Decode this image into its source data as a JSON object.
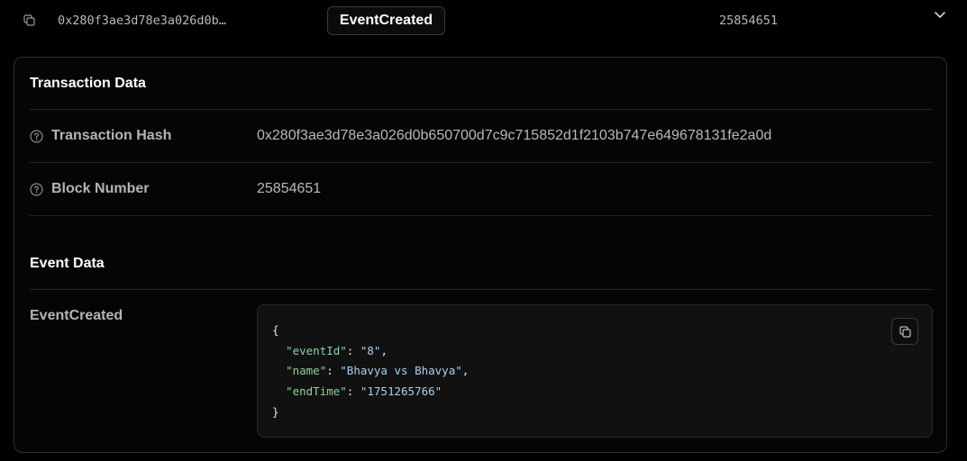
{
  "top": {
    "hash": "0x280f3ae3d78e3a026d0b…",
    "event_name": "EventCreated",
    "block": "25854651"
  },
  "transaction": {
    "title": "Transaction Data",
    "hash_label": "Transaction Hash",
    "hash_value": "0x280f3ae3d78e3a026d0b650700d7c9c715852d1f2103b747e649678131fe2a0d",
    "block_label": "Block Number",
    "block_value": "25854651"
  },
  "event": {
    "title": "Event Data",
    "label": "EventCreated",
    "json": {
      "open": "{",
      "close": "}",
      "fields": [
        {
          "key": "\"eventId\"",
          "value": "\"8\"",
          "sep": ","
        },
        {
          "key": "\"name\"",
          "value": "\"Bhavya vs Bhavya\"",
          "sep": ","
        },
        {
          "key": "\"endTime\"",
          "value": "\"1751265766\"",
          "sep": ""
        }
      ]
    }
  },
  "icons": {
    "copy": "copy-icon",
    "help": "help-circle-icon",
    "chevron": "chevron-down-icon"
  },
  "colors": {
    "background": "#000000",
    "json_key": "#8fd19e",
    "json_string": "#a9d1f0"
  }
}
